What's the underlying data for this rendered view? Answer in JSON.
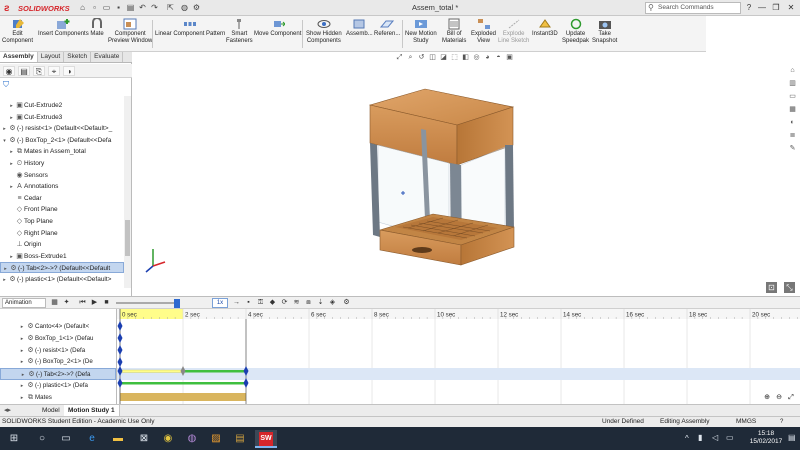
{
  "titlebar": {
    "app_name": "SOLIDWORKS",
    "document_title": "Assem_total *",
    "search_placeholder": "Search Commands",
    "help_label": "?",
    "minimize": "—",
    "restore": "❐",
    "close": "✕"
  },
  "commands": [
    {
      "label": "Edit\nComponent",
      "icon": "edit-component-icon"
    },
    {
      "label": "Insert Components",
      "icon": "insert-components-icon"
    },
    {
      "label": "Mate",
      "icon": "mate-icon"
    },
    {
      "label": "Component\nPreview Window",
      "icon": "component-preview-icon"
    },
    {
      "label": "Linear Component Pattern",
      "icon": "linear-pattern-icon"
    },
    {
      "label": "Smart\nFasteners",
      "icon": "smart-fasteners-icon"
    },
    {
      "label": "Move Component",
      "icon": "move-component-icon"
    },
    {
      "label": "Show Hidden\nComponents",
      "icon": "show-hidden-icon"
    },
    {
      "label": "Assemb...",
      "icon": "assembly-features-icon"
    },
    {
      "label": "Referen...",
      "icon": "reference-geometry-icon"
    },
    {
      "label": "New Motion\nStudy",
      "icon": "new-motion-study-icon"
    },
    {
      "label": "Bill of\nMaterials",
      "icon": "bill-of-materials-icon"
    },
    {
      "label": "Exploded\nView",
      "icon": "exploded-view-icon"
    },
    {
      "label": "Explode\nLine Sketch",
      "icon": "explode-line-sketch-icon"
    },
    {
      "label": "Instant3D",
      "icon": "instant3d-icon"
    },
    {
      "label": "Update\nSpeedpak",
      "icon": "update-speedpak-icon"
    },
    {
      "label": "Take\nSnapshot",
      "icon": "take-snapshot-icon"
    }
  ],
  "left_tabs": [
    "Assembly",
    "Layout",
    "Sketch",
    "Evaluate"
  ],
  "feature_tree": [
    {
      "label": "Cut-Extrude2",
      "arrow": "▸",
      "icon": "▣"
    },
    {
      "label": "Cut-Extrude3",
      "arrow": "▸",
      "icon": "▣"
    },
    {
      "label": "(-) resist<1> (Default<<Default>_",
      "arrow": "▸",
      "icon": "⚙"
    },
    {
      "label": "(-) BoxTop_2<1> (Default<<Defa",
      "arrow": "▾",
      "icon": "⚙"
    },
    {
      "label": "Mates in Assem_total",
      "arrow": "▸",
      "icon": "⧉"
    },
    {
      "label": "History",
      "arrow": "▸",
      "icon": "⏲"
    },
    {
      "label": "Sensors",
      "arrow": "",
      "icon": "◉"
    },
    {
      "label": "Annotations",
      "arrow": "▸",
      "icon": "A"
    },
    {
      "label": "Cedar",
      "arrow": "",
      "icon": "≡"
    },
    {
      "label": "Front Plane",
      "arrow": "",
      "icon": "◇"
    },
    {
      "label": "Top Plane",
      "arrow": "",
      "icon": "◇"
    },
    {
      "label": "Right Plane",
      "arrow": "",
      "icon": "◇"
    },
    {
      "label": "Origin",
      "arrow": "",
      "icon": "⊥"
    },
    {
      "label": "Boss-Extrude1",
      "arrow": "▸",
      "icon": "▣"
    },
    {
      "label": "(-) Tab<2>->? (Default<<Default",
      "arrow": "▸",
      "icon": "⚙",
      "selected": true
    },
    {
      "label": "(-) plastic<1> (Default<<Default>",
      "arrow": "▸",
      "icon": "⚙"
    }
  ],
  "motion": {
    "study_type": "Animation",
    "speed_value": "1x",
    "time_labels": [
      "0 sec",
      "2 sec",
      "4 sec",
      "6 sec",
      "8 sec",
      "10 sec",
      "12 sec",
      "14 sec",
      "16 sec",
      "18 sec",
      "20 sec"
    ],
    "tree": [
      {
        "label": "Canto<4> (Default<",
        "icon": "⚙"
      },
      {
        "label": "BoxTop_1<1> (Defau",
        "icon": "⚙"
      },
      {
        "label": "(-) resist<1> (Defa",
        "icon": "⚙"
      },
      {
        "label": "(-) BoxTop_2<1> (De",
        "icon": "⚙"
      },
      {
        "label": "(-) Tab<2>->? (Defa",
        "icon": "⚙",
        "selected": true
      },
      {
        "label": "(-) plastic<1> (Defa",
        "icon": "⚙"
      },
      {
        "label": "Mates",
        "icon": "⧉"
      }
    ]
  },
  "bottom_tabs": [
    "Model",
    "Motion Study 1"
  ],
  "statusbar": {
    "edition": "SOLIDWORKS Student Edition - Academic Use Only",
    "state": "Under Defined",
    "mode": "Editing Assembly",
    "units": "MMGS"
  },
  "taskbar": {
    "time": "15:18",
    "date": "15/02/2017"
  },
  "colors": {
    "accent": "#d6262b",
    "wood": "#d4935a",
    "frame": "#7b8794",
    "timeline_green": "#3fbf3f",
    "timeline_yellow": "#fffd8a",
    "keypoint_blue": "#1b3fb0"
  }
}
